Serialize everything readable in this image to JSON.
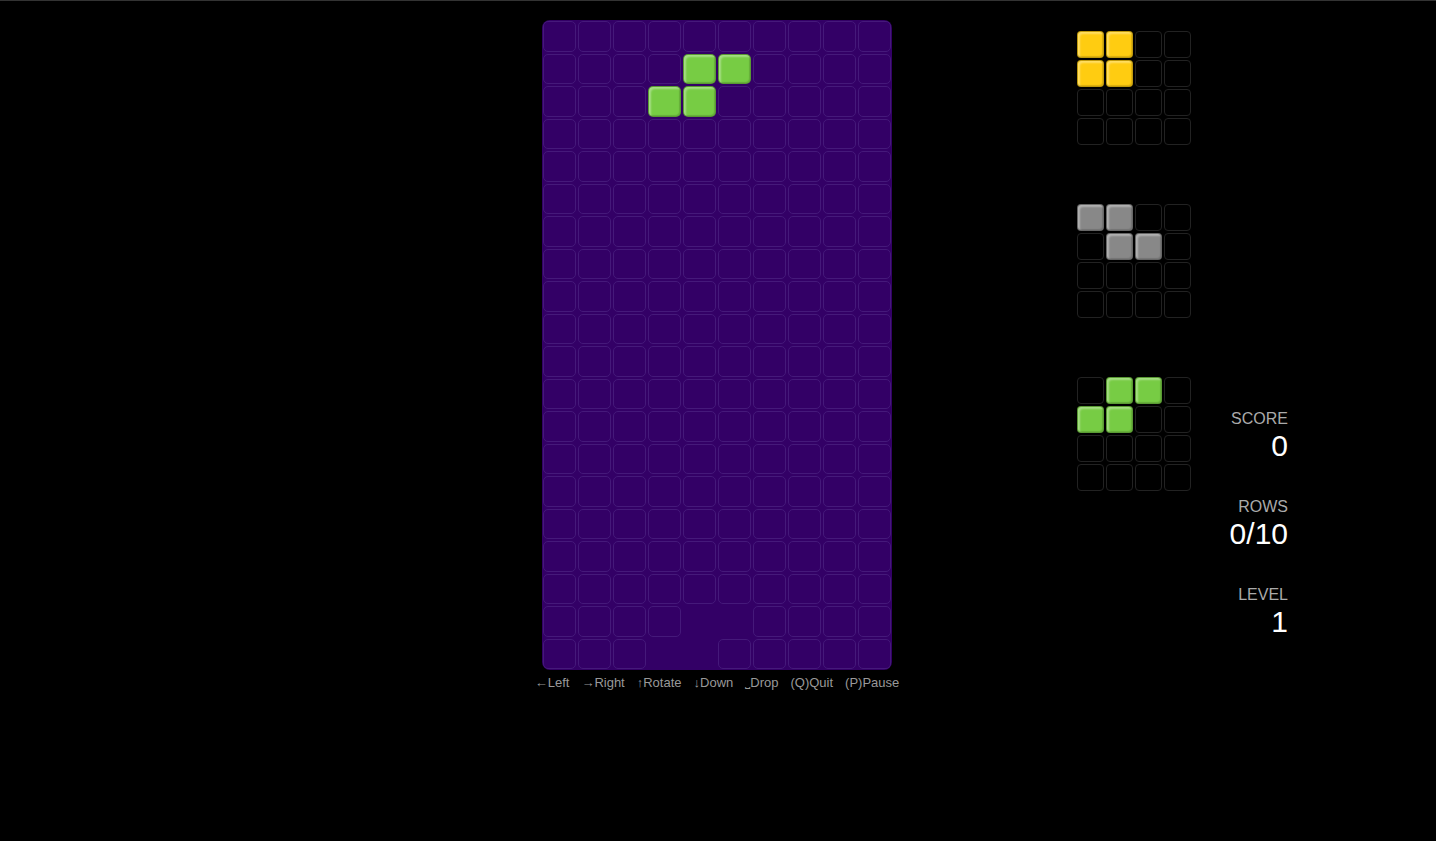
{
  "board": {
    "columns": 10,
    "rows": 20,
    "piece": {
      "color": "#77cc44",
      "cells": [
        [
          1,
          4
        ],
        [
          1,
          5
        ],
        [
          2,
          3
        ],
        [
          2,
          4
        ]
      ]
    },
    "ghost": {
      "cells": [
        [
          18,
          4
        ],
        [
          18,
          5
        ],
        [
          19,
          3
        ],
        [
          19,
          4
        ]
      ]
    }
  },
  "next": [
    {
      "color": "#ffcc11",
      "cells": [
        [
          0,
          0
        ],
        [
          0,
          1
        ],
        [
          1,
          0
        ],
        [
          1,
          1
        ]
      ]
    },
    {
      "color": "#888888",
      "cells": [
        [
          0,
          0
        ],
        [
          0,
          1
        ],
        [
          1,
          1
        ],
        [
          1,
          2
        ]
      ]
    },
    {
      "color": "#77cc44",
      "cells": [
        [
          0,
          1
        ],
        [
          0,
          2
        ],
        [
          1,
          0
        ],
        [
          1,
          1
        ]
      ]
    }
  ],
  "stats": [
    {
      "label": "SCORE",
      "value": "0"
    },
    {
      "label": "ROWS",
      "value": "0/10"
    },
    {
      "label": "LEVEL",
      "value": "1"
    }
  ],
  "controls": [
    "←Left",
    "→Right",
    "↑Rotate",
    "↓Down",
    "⎵Drop",
    "(Q)Quit",
    "(P)Pause"
  ]
}
